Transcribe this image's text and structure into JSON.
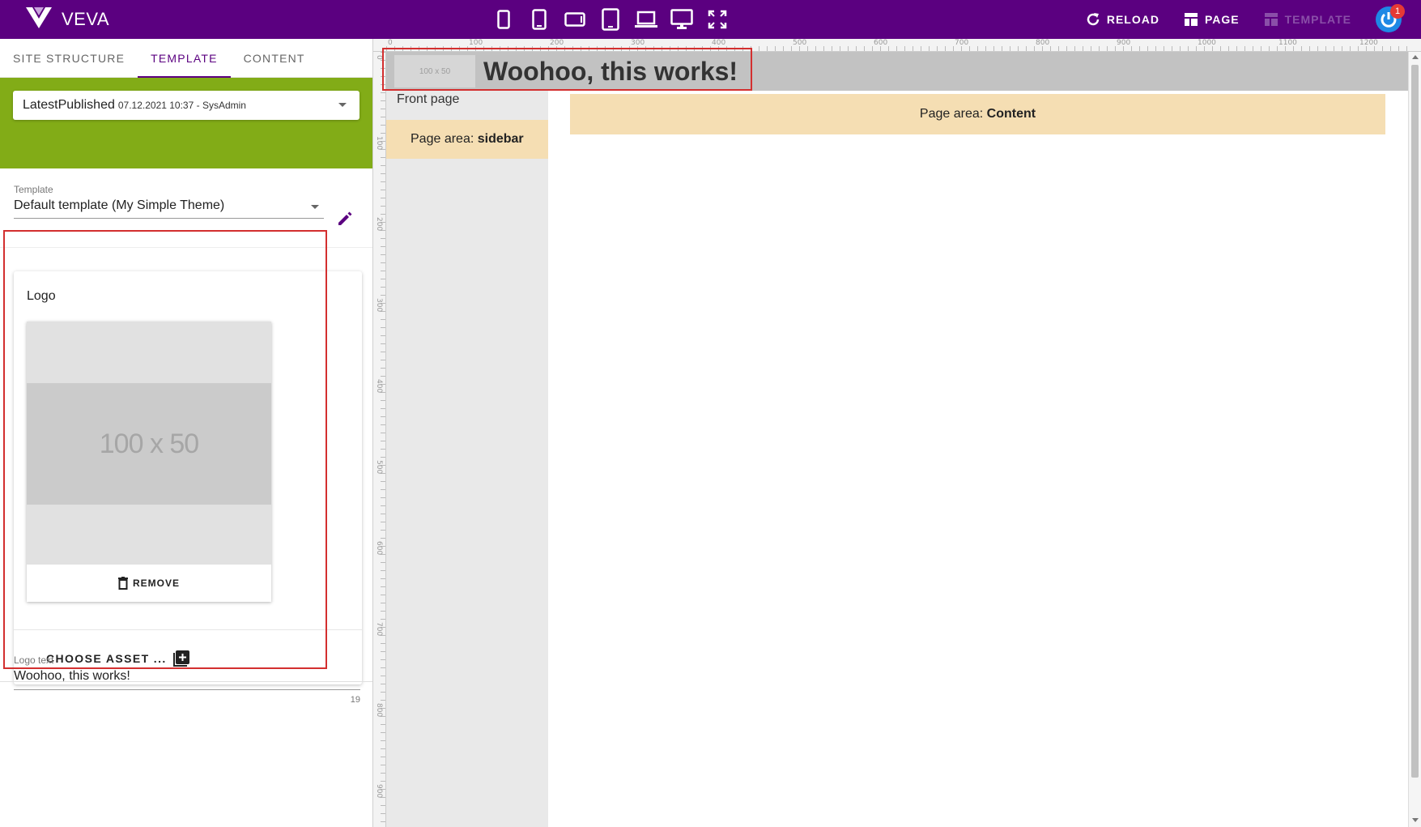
{
  "app": {
    "brand": "VEVA",
    "colors": {
      "topbar": "#5b0080",
      "accent": "#5b0080",
      "green_band": "#82ac17",
      "page_area": "#f5deb3",
      "highlight_outline": "#d32f2f"
    },
    "devices": [
      "phone-small-icon",
      "phone-icon",
      "phone-landscape-icon",
      "tablet-icon",
      "laptop-icon",
      "desktop-icon",
      "fullscreen-icon"
    ],
    "actions": {
      "reload": "RELOAD",
      "page": "PAGE",
      "template": "TEMPLATE"
    },
    "notification_count": "1"
  },
  "sidebar": {
    "tabs": [
      {
        "label": "SITE STRUCTURE",
        "active": false
      },
      {
        "label": "TEMPLATE",
        "active": true
      },
      {
        "label": "CONTENT",
        "active": false
      }
    ],
    "version": {
      "name": "LatestPublished",
      "meta": "07.12.2021 10:37 - SysAdmin"
    },
    "template": {
      "label": "Template",
      "value": "Default template (My Simple Theme)"
    },
    "logo": {
      "title": "Logo",
      "image_placeholder": "100 x 50",
      "remove_label": "REMOVE",
      "choose_label": "CHOOSE ASSET ..."
    },
    "logo_text": {
      "label": "Logo text",
      "value": "Woohoo, this works!",
      "char_count": "19"
    }
  },
  "preview": {
    "ruler_top": [
      "0",
      "100",
      "200",
      "300",
      "400",
      "500",
      "600",
      "700",
      "800",
      "900",
      "1000",
      "1100",
      "1200"
    ],
    "ruler_left": [
      "0",
      "100",
      "200",
      "300",
      "400",
      "500",
      "600",
      "700",
      "800",
      "900"
    ],
    "header": {
      "logo_placeholder": "100 x 50",
      "logo_text": "Woohoo, this works!"
    },
    "nav": {
      "front_page": "Front page"
    },
    "sidebar_area": {
      "prefix": "Page area: ",
      "name": "sidebar"
    },
    "content_area": {
      "prefix": "Page area: ",
      "name": "Content"
    }
  }
}
